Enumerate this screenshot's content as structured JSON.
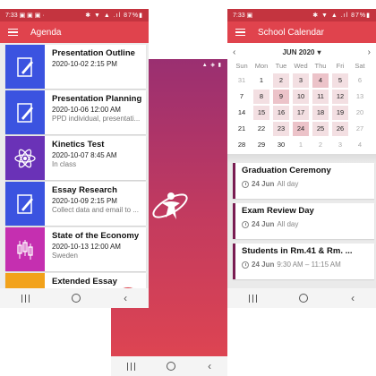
{
  "center": {
    "status_icons": "▲ ◈ ▮"
  },
  "agenda": {
    "status": {
      "time": "7:33",
      "icons_left": "▣ ▣ ▣ ·",
      "icons_right": "✱ ▼ ▲ .ıl 87%▮"
    },
    "title": "Agenda",
    "items": [
      {
        "title": "Presentation Outline",
        "date": "2020-10-02 2:15 PM",
        "sub": "",
        "icon": "pencil-paper-icon",
        "color": "#3b53e0"
      },
      {
        "title": "Presentation Planning",
        "date": "2020-10-06 12:00 AM",
        "sub": "PPD individual, presentati...",
        "icon": "pencil-paper-icon",
        "color": "#3b53e0"
      },
      {
        "title": "Kinetics Test",
        "date": "2020-10-07 8:45 AM",
        "sub": "In class",
        "icon": "atom-icon",
        "color": "#6a32b7"
      },
      {
        "title": "Essay Research",
        "date": "2020-10-09 2:15 PM",
        "sub": "Collect data and email to ...",
        "icon": "pencil-paper-icon",
        "color": "#3b53e0"
      },
      {
        "title": "State of the Economy",
        "date": "2020-10-13 12:00 AM",
        "sub": "Sweden",
        "icon": "candlestick-chart-icon",
        "color": "#c52fb0"
      },
      {
        "title": "Extended Essay",
        "date": "",
        "sub": "",
        "icon": "pen-icon",
        "color": "#f2a21b"
      }
    ],
    "fab_label": "+"
  },
  "calendar": {
    "status": {
      "time": "7:33",
      "icons_left": "▣",
      "icons_right": "✱ ▼ ▲ .ıl 87%▮"
    },
    "title": "School Calendar",
    "month": "JUN 2020",
    "prev": "‹",
    "next": "›",
    "caret": "▾",
    "weekdays": [
      "Sun",
      "Mon",
      "Tue",
      "Wed",
      "Thu",
      "Fri",
      "Sat"
    ],
    "days": [
      {
        "n": "31",
        "k": "other"
      },
      {
        "n": "1",
        "k": ""
      },
      {
        "n": "2",
        "k": "ev1"
      },
      {
        "n": "3",
        "k": "ev1"
      },
      {
        "n": "4",
        "k": "ev2"
      },
      {
        "n": "5",
        "k": "ev1"
      },
      {
        "n": "6",
        "k": "other"
      },
      {
        "n": "7",
        "k": ""
      },
      {
        "n": "8",
        "k": "ev1"
      },
      {
        "n": "9",
        "k": "ev2"
      },
      {
        "n": "10",
        "k": "ev1"
      },
      {
        "n": "11",
        "k": "ev1"
      },
      {
        "n": "12",
        "k": "ev1"
      },
      {
        "n": "13",
        "k": "other"
      },
      {
        "n": "14",
        "k": ""
      },
      {
        "n": "15",
        "k": "ev1"
      },
      {
        "n": "16",
        "k": "ev1"
      },
      {
        "n": "17",
        "k": "ev1"
      },
      {
        "n": "18",
        "k": "ev1"
      },
      {
        "n": "19",
        "k": "ev1"
      },
      {
        "n": "20",
        "k": "other"
      },
      {
        "n": "21",
        "k": ""
      },
      {
        "n": "22",
        "k": "sel"
      },
      {
        "n": "23",
        "k": "ev1"
      },
      {
        "n": "24",
        "k": "ev2"
      },
      {
        "n": "25",
        "k": "ev1"
      },
      {
        "n": "26",
        "k": "ev1"
      },
      {
        "n": "27",
        "k": "other"
      },
      {
        "n": "28",
        "k": ""
      },
      {
        "n": "29",
        "k": ""
      },
      {
        "n": "30",
        "k": ""
      },
      {
        "n": "1",
        "k": "other"
      },
      {
        "n": "2",
        "k": "other"
      },
      {
        "n": "3",
        "k": "other"
      },
      {
        "n": "4",
        "k": "other"
      }
    ],
    "events": [
      {
        "title": "Graduation Ceremony",
        "date": "24 Jun",
        "time": "All day"
      },
      {
        "title": "Exam Review Day",
        "date": "24 Jun",
        "time": "All day"
      },
      {
        "title": "Students in Rm.41 & Rm. ...",
        "date": "24 Jun",
        "time": "9:30 AM – 11:15 AM"
      }
    ]
  },
  "colors": {
    "accent": "#e0434d",
    "status": "#c4343f",
    "splash_top": "#9a2f71",
    "splash_bottom": "#dd4452"
  }
}
